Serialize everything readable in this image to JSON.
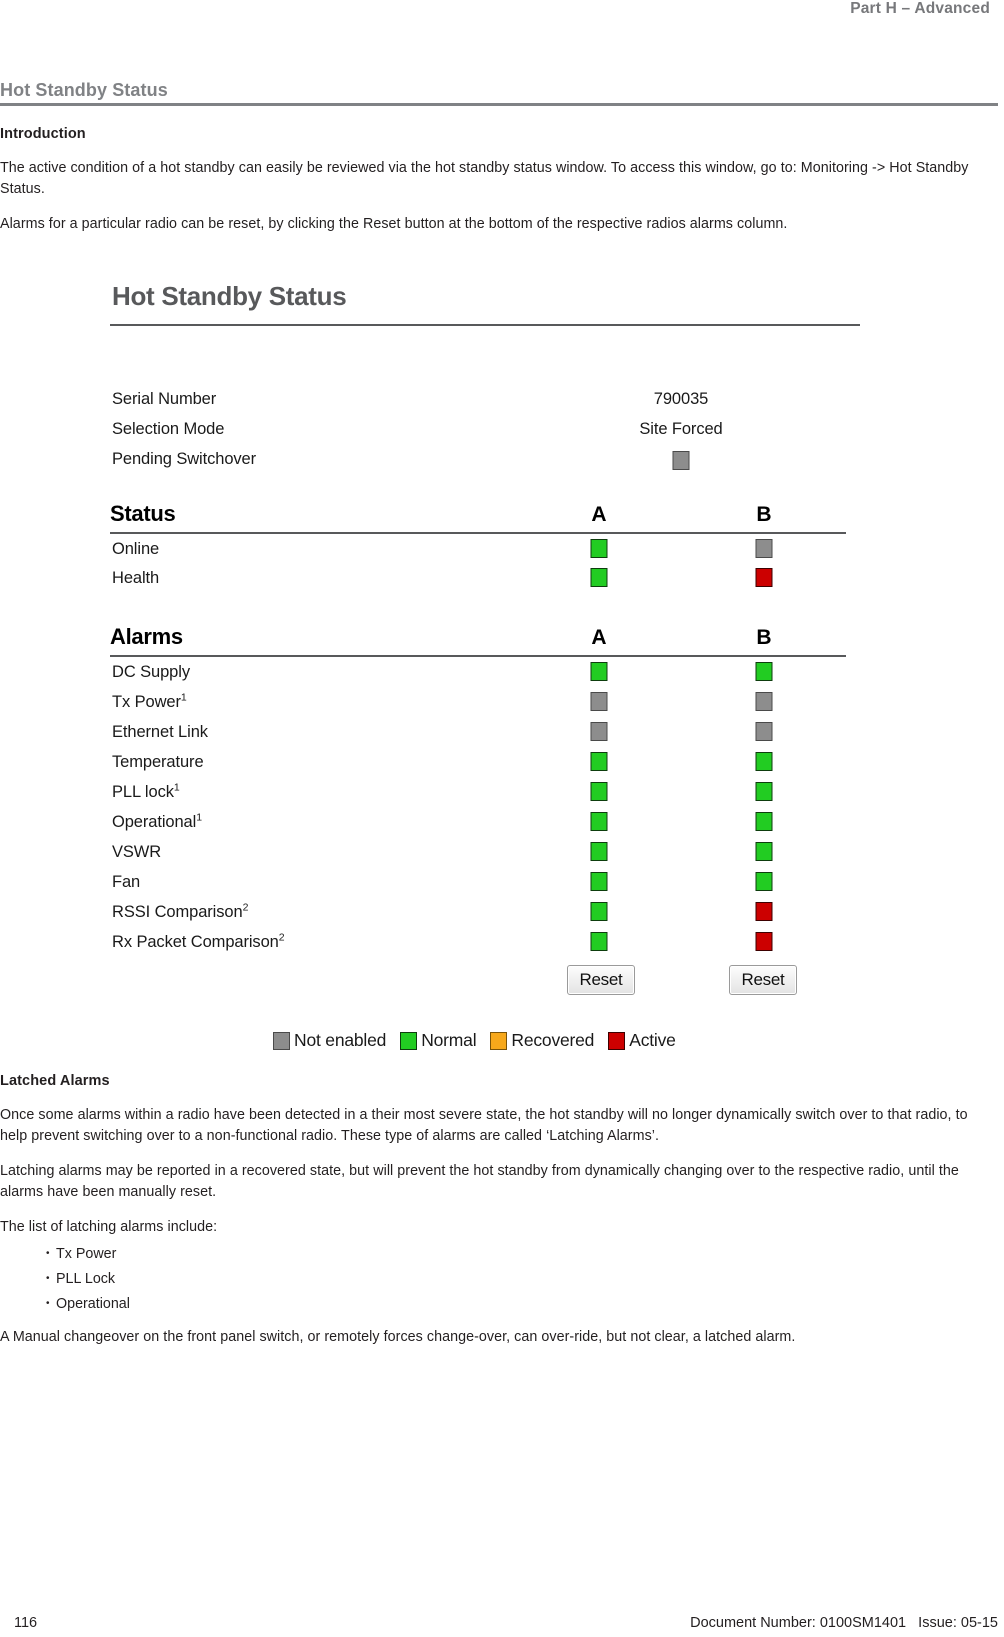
{
  "header": {
    "running_head": "Part H – Advanced"
  },
  "section": {
    "title": "Hot Standby Status"
  },
  "intro": {
    "heading": "Introduction",
    "paragraph1": "The active condition of a hot standby can easily be reviewed via the hot standby status window. To access this window, go to: Monitoring -> Hot Standby Status.",
    "paragraph2": "Alarms for a particular radio can be reset, by clicking the Reset button at the bottom of the respective radios alarms column."
  },
  "figure": {
    "title": "Hot Standby Status",
    "info": [
      {
        "label": "Serial Number",
        "value": "790035"
      },
      {
        "label": "Selection Mode",
        "value": "Site Forced"
      },
      {
        "label": "Pending Switchover",
        "value": "",
        "indicator": "gray"
      }
    ],
    "status_table": {
      "heading": "Status",
      "columns": [
        "A",
        "B"
      ],
      "rows": [
        {
          "label": "Online",
          "a": "green",
          "b": "gray"
        },
        {
          "label": "Health",
          "a": "green",
          "b": "red"
        }
      ]
    },
    "alarms_table": {
      "heading": "Alarms",
      "columns": [
        "A",
        "B"
      ],
      "rows": [
        {
          "label": "DC Supply",
          "sup": "",
          "a": "green",
          "b": "green"
        },
        {
          "label": "Tx Power",
          "sup": "1",
          "a": "gray",
          "b": "gray"
        },
        {
          "label": "Ethernet Link",
          "sup": "",
          "a": "gray",
          "b": "gray"
        },
        {
          "label": "Temperature",
          "sup": "",
          "a": "green",
          "b": "green"
        },
        {
          "label": "PLL lock",
          "sup": "1",
          "a": "green",
          "b": "green"
        },
        {
          "label": "Operational",
          "sup": "1",
          "a": "green",
          "b": "green"
        },
        {
          "label": "VSWR",
          "sup": "",
          "a": "green",
          "b": "green"
        },
        {
          "label": "Fan",
          "sup": "",
          "a": "green",
          "b": "green"
        },
        {
          "label": "RSSI Comparison",
          "sup": "2",
          "a": "green",
          "b": "red"
        },
        {
          "label": "Rx Packet Comparison",
          "sup": "2",
          "a": "green",
          "b": "red"
        }
      ],
      "reset_a_label": "Reset",
      "reset_b_label": "Reset"
    },
    "legend": [
      {
        "color": "gray",
        "label": "Not enabled"
      },
      {
        "color": "green",
        "label": "Normal"
      },
      {
        "color": "orange",
        "label": "Recovered"
      },
      {
        "color": "red",
        "label": "Active"
      }
    ],
    "colors": {
      "gray": "#8d8d8d",
      "green": "#22cc22",
      "orange": "#f7a81b",
      "red": "#cc0000"
    }
  },
  "latched": {
    "heading": "Latched Alarms",
    "paragraph1": "Once some alarms within a radio have been detected in a their most severe state, the hot standby will no longer dynamically switch over to that radio, to help prevent switching over to a non-functional radio. These type of alarms are called ‘Latching Alarms’.",
    "paragraph2": "Latching alarms may be reported in a recovered state, but will prevent the hot standby from dynamically changing over to the respective radio, until the alarms have been manually reset.",
    "list_intro": "The list of latching alarms include:",
    "list": [
      "Tx Power",
      "PLL Lock",
      "Operational"
    ],
    "paragraph3": "A Manual changeover on the front panel switch, or remotely forces change-over, can over-ride, but not clear, a latched alarm."
  },
  "footer": {
    "page_number": "116",
    "document_info": "Document Number: 0100SM1401   Issue: 05-15"
  }
}
